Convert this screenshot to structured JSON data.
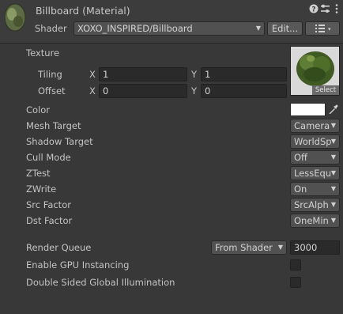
{
  "header": {
    "title": "Billboard (Material)",
    "shader_label": "Shader",
    "shader_value": "XOXO_INSPIRED/Billboard",
    "edit_button": "Edit...",
    "list_icon": "list-icon"
  },
  "texture": {
    "label": "Texture",
    "tiling_label": "Tiling",
    "offset_label": "Offset",
    "tiling_x": "1",
    "tiling_y": "1",
    "offset_x": "0",
    "offset_y": "0",
    "x_axis": "X",
    "y_axis": "Y",
    "select_label": "Select"
  },
  "properties": {
    "color_label": "Color",
    "color_value": "#ffffff",
    "mesh_target_label": "Mesh Target",
    "mesh_target_value": "Camera",
    "shadow_target_label": "Shadow Target",
    "shadow_target_value": "WorldSp",
    "cull_mode_label": "Cull Mode",
    "cull_mode_value": "Off",
    "ztest_label": "ZTest",
    "ztest_value": "LessEqu",
    "zwrite_label": "ZWrite",
    "zwrite_value": "On",
    "src_factor_label": "Src Factor",
    "src_factor_value": "SrcAlph",
    "dst_factor_label": "Dst Factor",
    "dst_factor_value": "OneMin"
  },
  "advanced": {
    "render_queue_label": "Render Queue",
    "render_queue_mode": "From Shader",
    "render_queue_value": "3000",
    "gpu_instancing_label": "Enable GPU Instancing",
    "gpu_instancing_checked": false,
    "double_sided_gi_label": "Double Sided Global Illumination",
    "double_sided_gi_checked": false
  }
}
